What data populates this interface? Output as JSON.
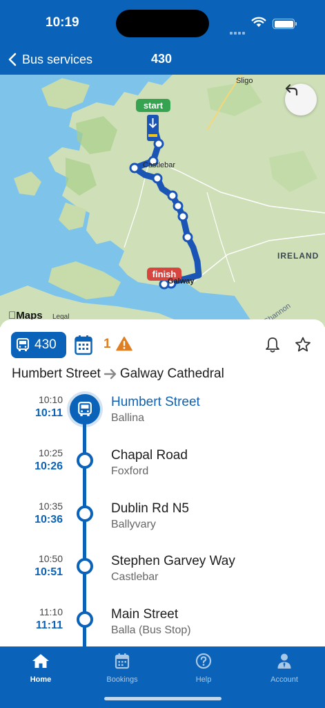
{
  "status": {
    "time": "10:19"
  },
  "nav": {
    "back_label": "Bus services",
    "title": "430"
  },
  "map": {
    "labels": {
      "sligo": "Sligo",
      "castlebar": "Castlebar",
      "galway": "Galway",
      "ireland": "IRELAND",
      "shannon": "Shannon"
    },
    "start_label": "start",
    "finish_label": "finish",
    "brand": "Maps",
    "legal": "Legal"
  },
  "route": {
    "number": "430",
    "alert_count": "1",
    "from": "Humbert Street",
    "to": "Galway Cathedral"
  },
  "stops": [
    {
      "scheduled": "10:10",
      "actual": "10:11",
      "name": "Humbert Street",
      "town": "Ballina",
      "current": true
    },
    {
      "scheduled": "10:25",
      "actual": "10:26",
      "name": "Chapal Road",
      "town": "Foxford"
    },
    {
      "scheduled": "10:35",
      "actual": "10:36",
      "name": "Dublin Rd N5",
      "town": "Ballyvary"
    },
    {
      "scheduled": "10:50",
      "actual": "10:51",
      "name": "Stephen Garvey Way",
      "town": "Castlebar"
    },
    {
      "scheduled": "11:10",
      "actual": "11:11",
      "name": "Main Street",
      "town": "Balla (Bus Stop)"
    }
  ],
  "tabs": [
    {
      "label": "Home",
      "icon": "home-icon",
      "active": true
    },
    {
      "label": "Bookings",
      "icon": "calendar-icon"
    },
    {
      "label": "Help",
      "icon": "help-icon"
    },
    {
      "label": "Account",
      "icon": "account-icon"
    }
  ],
  "colors": {
    "brand_blue": "#0a63b8",
    "start_green": "#35a34f",
    "finish_red": "#d8453f",
    "alert_orange": "#e07e22",
    "water": "#7ec4ea",
    "land": "#cfe0b8"
  }
}
